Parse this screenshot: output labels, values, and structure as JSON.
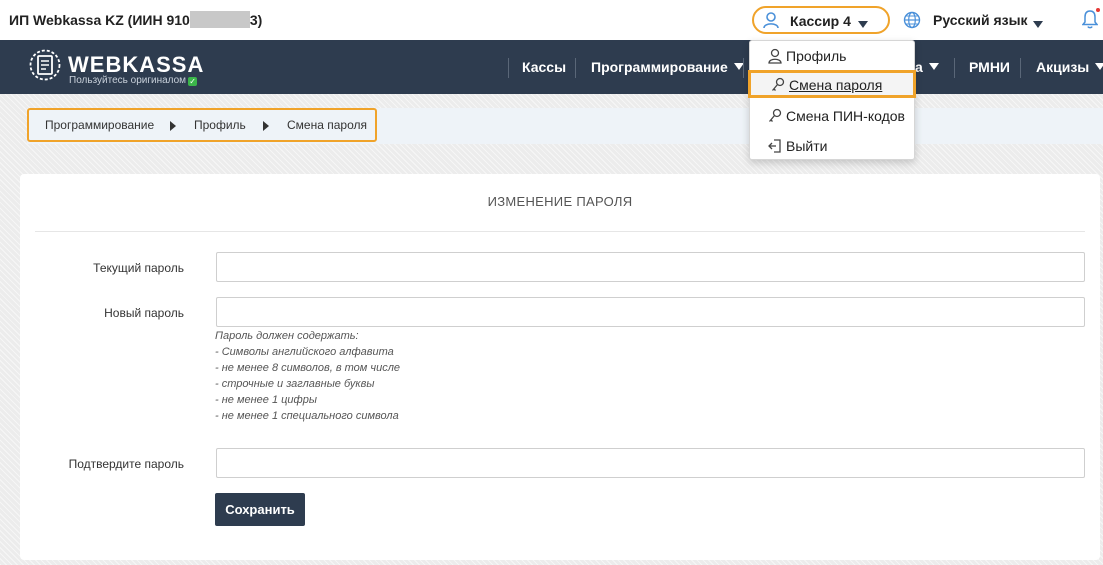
{
  "topbar": {
    "company_prefix": "ИП Webkassa KZ (ИИН 910",
    "company_suffix": "3)",
    "user_label": "Кассир 4",
    "language_label": "Русский язык"
  },
  "brand": {
    "name": "WEBKASSA",
    "tagline": "Пользуйтесь оригиналом"
  },
  "nav": {
    "items": [
      {
        "label": "Кассы",
        "has_caret": false
      },
      {
        "label": "Программирование",
        "has_caret": true
      },
      {
        "label": "а",
        "has_caret": true
      },
      {
        "label": "РМНИ",
        "has_caret": false
      },
      {
        "label": "Акцизы",
        "has_caret": true
      }
    ]
  },
  "dropdown": {
    "items": [
      {
        "label": "Профиль",
        "icon": "person-icon"
      },
      {
        "label": "Смена пароля",
        "icon": "key-icon",
        "active": true
      },
      {
        "label": "Смена ПИН-кодов",
        "icon": "key-icon"
      },
      {
        "label": "Выйти",
        "icon": "logout-icon"
      }
    ]
  },
  "breadcrumb": [
    "Программирование",
    "Профиль",
    "Смена пароля"
  ],
  "form": {
    "title": "ИЗМЕНЕНИЕ ПАРОЛЯ",
    "current_password_label": "Текущий пароль",
    "new_password_label": "Новый пароль",
    "confirm_password_label": "Подтвердите пароль",
    "current_password_value": "",
    "new_password_value": "",
    "confirm_password_value": "",
    "hint_lines": [
      "Пароль должен содержать:",
      "- Символы английского алфавита",
      "- не менее 8 символов, в том числе",
      "- строчные и заглавные буквы",
      "- не менее 1 цифры",
      "- не менее 1 специального символа"
    ],
    "save_label": "Сохранить"
  },
  "colors": {
    "navbar": "#2e3c4f",
    "highlight": "#f0a32a",
    "accent_icon": "#4a90d9"
  }
}
